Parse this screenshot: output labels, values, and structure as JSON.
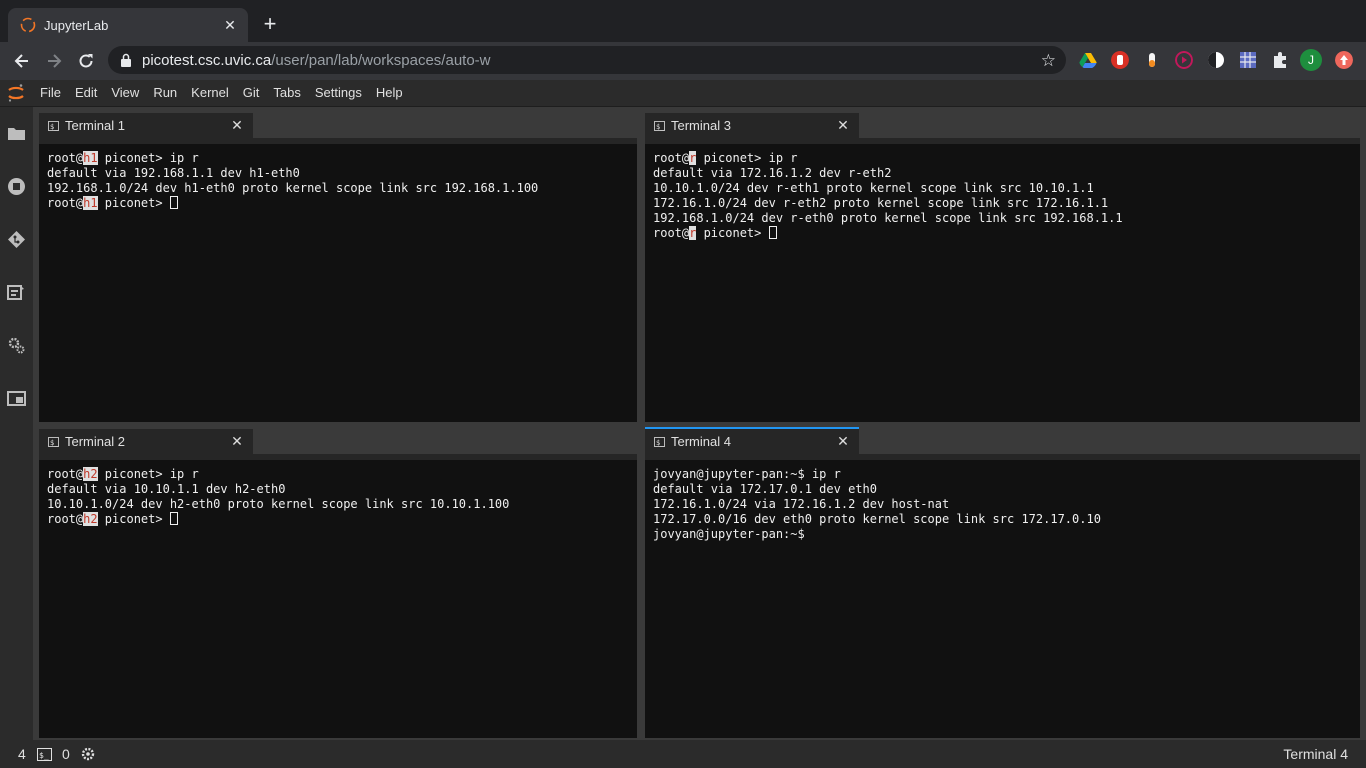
{
  "browser": {
    "tab_title": "JupyterLab",
    "url_host": "picotest.csc.uvic.ca",
    "url_path": "/user/pan/lab/workspaces/auto-w",
    "profile_initial": "J"
  },
  "menu": [
    "File",
    "Edit",
    "View",
    "Run",
    "Kernel",
    "Git",
    "Tabs",
    "Settings",
    "Help"
  ],
  "terminals": {
    "t1": {
      "title": "Terminal 1",
      "lines": [
        {
          "pre": "root@",
          "host": "h1",
          "post": " piconet> ip r"
        },
        {
          "text": "default via 192.168.1.1 dev h1-eth0"
        },
        {
          "text": "192.168.1.0/24 dev h1-eth0 proto kernel scope link src 192.168.1.100"
        },
        {
          "pre": "root@",
          "host": "h1",
          "post": " piconet> "
        }
      ]
    },
    "t3": {
      "title": "Terminal 3",
      "lines": [
        {
          "pre": "root@",
          "host": "r",
          "post": " piconet> ip r"
        },
        {
          "text": "default via 172.16.1.2 dev r-eth2"
        },
        {
          "text": "10.10.1.0/24 dev r-eth1 proto kernel scope link src 10.10.1.1"
        },
        {
          "text": "172.16.1.0/24 dev r-eth2 proto kernel scope link src 172.16.1.1"
        },
        {
          "text": "192.168.1.0/24 dev r-eth0 proto kernel scope link src 192.168.1.1"
        },
        {
          "pre": "root@",
          "host": "r",
          "post": " piconet> "
        }
      ]
    },
    "t2": {
      "title": "Terminal 2",
      "lines": [
        {
          "pre": "root@",
          "host": "h2",
          "post": " piconet> ip r"
        },
        {
          "text": "default via 10.10.1.1 dev h2-eth0"
        },
        {
          "text": "10.10.1.0/24 dev h2-eth0 proto kernel scope link src 10.10.1.100"
        },
        {
          "pre": "root@",
          "host": "h2",
          "post": " piconet> "
        }
      ]
    },
    "t4": {
      "title": "Terminal 4",
      "lines": [
        {
          "text": "jovyan@jupyter-pan:~$ ip r"
        },
        {
          "text": "default via 172.17.0.1 dev eth0"
        },
        {
          "text": "172.16.1.0/24 via 172.16.1.2 dev host-nat"
        },
        {
          "text": "172.17.0.0/16 dev eth0 proto kernel scope link src 172.17.0.10"
        },
        {
          "text": "jovyan@jupyter-pan:~$"
        }
      ]
    }
  },
  "status": {
    "terminal_count": "4",
    "kernel_count": "0",
    "active_tab": "Terminal 4"
  }
}
